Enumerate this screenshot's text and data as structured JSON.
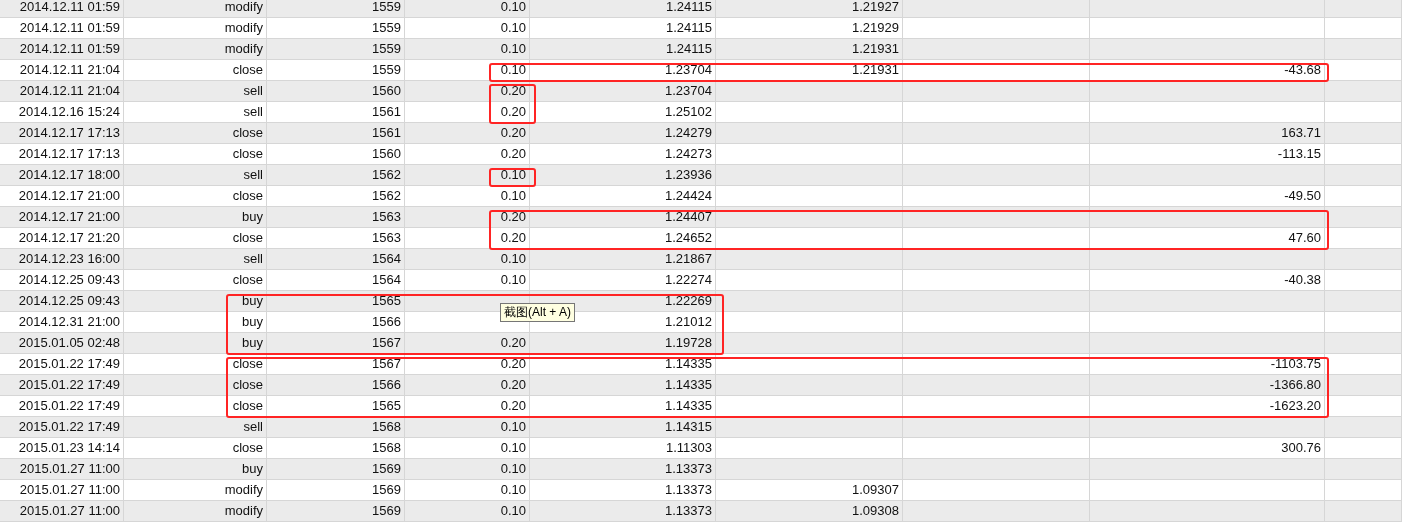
{
  "table": {
    "rows": [
      {
        "kind": "plain",
        "column_1": "2014.12.11 01:59",
        "column_2": "modify",
        "column_3": "1559",
        "column_4": "0.10",
        "column_5": "1.24115",
        "column_6": "1.21927"
      },
      {
        "kind": "plain",
        "column_1": "2014.12.11 01:59",
        "column_2": "modify",
        "column_3": "1559",
        "column_4": "0.10",
        "column_5": "1.24115",
        "column_6": "1.21929"
      },
      {
        "kind": "plain",
        "column_1": "2014.12.11 01:59",
        "column_2": "modify",
        "column_3": "1559",
        "column_4": "0.10",
        "column_5": "1.24115",
        "column_6": "1.21931"
      },
      {
        "kind": "wide",
        "column_1": "2014.12.11 21:04",
        "column_2": "close",
        "column_3": "1559",
        "column_4": "0.10",
        "column_5": "1.23704",
        "column_6": "1.21931",
        "column_8": "-43.68"
      },
      {
        "kind": "size",
        "column_1": "2014.12.11 21:04",
        "column_2": "sell",
        "column_3": "1560",
        "column_4": "0.20",
        "column_5": "1.23704"
      },
      {
        "kind": "size",
        "column_1": "2014.12.16 15:24",
        "column_2": "sell",
        "column_3": "1561",
        "column_4": "0.20",
        "column_5": "1.25102"
      },
      {
        "kind": "plain",
        "column_1": "2014.12.17 17:13",
        "column_2": "close",
        "column_3": "1561",
        "column_4": "0.20",
        "column_5": "1.24279",
        "column_8": "163.71"
      },
      {
        "kind": "plain",
        "column_1": "2014.12.17 17:13",
        "column_2": "close",
        "column_3": "1560",
        "column_4": "0.20",
        "column_5": "1.24273",
        "column_8": "-113.15"
      },
      {
        "kind": "size",
        "column_1": "2014.12.17 18:00",
        "column_2": "sell",
        "column_3": "1562",
        "column_4": "0.10",
        "column_5": "1.23936"
      },
      {
        "kind": "plain",
        "column_1": "2014.12.17 21:00",
        "column_2": "close",
        "column_3": "1562",
        "column_4": "0.10",
        "column_5": "1.24424",
        "column_8": "-49.50"
      },
      {
        "kind": "wide",
        "column_1": "2014.12.17 21:00",
        "column_2": "buy",
        "column_3": "1563",
        "column_4": "0.20",
        "column_5": "1.24407"
      },
      {
        "kind": "wide",
        "column_1": "2014.12.17 21:20",
        "column_2": "close",
        "column_3": "1563",
        "column_4": "0.20",
        "column_5": "1.24652",
        "column_8": "47.60"
      },
      {
        "kind": "plain",
        "column_1": "2014.12.23 16:00",
        "column_2": "sell",
        "column_3": "1564",
        "column_4": "0.10",
        "column_5": "1.21867"
      },
      {
        "kind": "plain",
        "column_1": "2014.12.25 09:43",
        "column_2": "close",
        "column_3": "1564",
        "column_4": "0.10",
        "column_5": "1.22274",
        "column_8": "-40.38"
      },
      {
        "kind": "middle",
        "column_1": "2014.12.25 09:43",
        "column_2": "buy",
        "column_3": "1565",
        "column_5": "1.22269"
      },
      {
        "kind": "middle",
        "column_1": "2014.12.31 21:00",
        "column_2": "buy",
        "column_3": "1566",
        "column_5": "1.21012"
      },
      {
        "kind": "middle",
        "column_1": "2015.01.05 02:48",
        "column_2": "buy",
        "column_3": "1567",
        "column_4": "0.20",
        "column_5": "1.19728"
      },
      {
        "kind": "long",
        "column_1": "2015.01.22 17:49",
        "column_2": "close",
        "column_3": "1567",
        "column_4": "0.20",
        "column_5": "1.14335",
        "column_8": "-1103.75"
      },
      {
        "kind": "long",
        "column_1": "2015.01.22 17:49",
        "column_2": "close",
        "column_3": "1566",
        "column_4": "0.20",
        "column_5": "1.14335",
        "column_8": "-1366.80"
      },
      {
        "kind": "long",
        "column_1": "2015.01.22 17:49",
        "column_2": "close",
        "column_3": "1565",
        "column_4": "0.20",
        "column_5": "1.14335",
        "column_8": "-1623.20"
      },
      {
        "kind": "plain",
        "column_1": "2015.01.22 17:49",
        "column_2": "sell",
        "column_3": "1568",
        "column_4": "0.10",
        "column_5": "1.14315"
      },
      {
        "kind": "plain",
        "column_1": "2015.01.23 14:14",
        "column_2": "close",
        "column_3": "1568",
        "column_4": "0.10",
        "column_5": "1.11303",
        "column_8": "300.76"
      },
      {
        "kind": "plain",
        "column_1": "2015.01.27 11:00",
        "column_2": "buy",
        "column_3": "1569",
        "column_4": "0.10",
        "column_5": "1.13373"
      },
      {
        "kind": "plain",
        "column_1": "2015.01.27 11:00",
        "column_2": "modify",
        "column_3": "1569",
        "column_4": "0.10",
        "column_5": "1.13373",
        "column_6": "1.09307"
      },
      {
        "kind": "plain",
        "column_1": "2015.01.27 11:00",
        "column_2": "modify",
        "column_3": "1569",
        "column_4": "0.10",
        "column_5": "1.13373",
        "column_6": "1.09308"
      }
    ]
  },
  "tooltip": {
    "text": "截图(Alt + A)"
  }
}
